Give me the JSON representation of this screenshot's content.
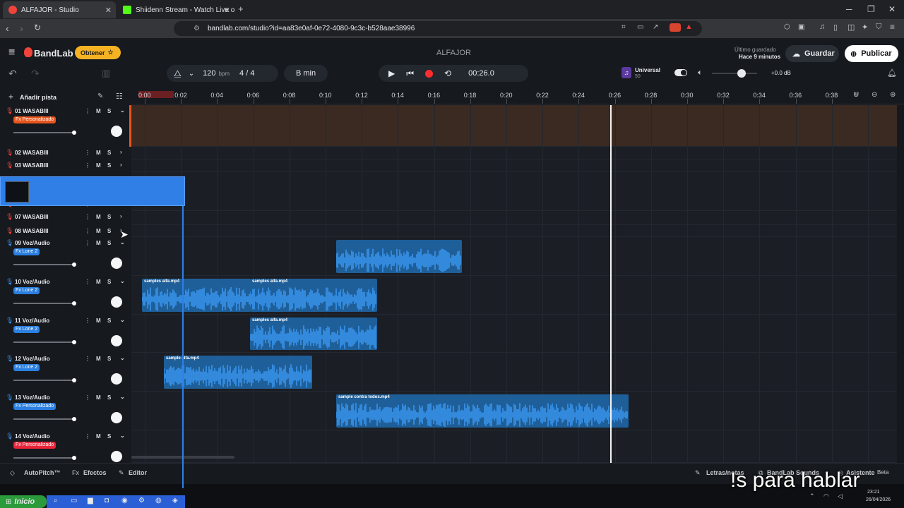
{
  "browser": {
    "tabs": [
      {
        "title": "ALFAJOR - Studio",
        "favicon_color": "#f0443a",
        "close": "✕"
      },
      {
        "title": "Shiidenn Stream - Watch Live on Kick",
        "favicon_color": "#53fc18",
        "close": "✕"
      }
    ],
    "new_tab": "+",
    "url": "bandlab.com/studio?id=aa83e0af-0e72-4080-9c3c-b528aae38996",
    "window_controls": {
      "minimize": "─",
      "maximize": "❐",
      "close": "✕"
    }
  },
  "app": {
    "brand": "BandLab",
    "obtener_label": "Obtener",
    "project_title": "ALFAJOR",
    "last_saved_label": "Último guardado",
    "last_saved_time": "Hace 9 minutos",
    "save_label": "Guardar",
    "publish_label": "Publicar",
    "tempo": "120",
    "tempo_unit": "bpm",
    "time_signature": "4 / 4",
    "key": "B min",
    "time_display": "00:26.0",
    "instrument_name": "Universal",
    "instrument_value": "50",
    "master_volume": "+0.0 dB",
    "master_volume_level": 0.65,
    "add_track_label": "Añadir pista",
    "accent_color": "#f0443a",
    "record_color": "#ff2d2d"
  },
  "ruler": {
    "ticks": [
      "0:00",
      "0:02",
      "0:04",
      "0:06",
      "0:08",
      "0:10",
      "0:12",
      "0:14",
      "0:16",
      "0:18",
      "0:20",
      "0:22",
      "0:24",
      "0:26",
      "0:28",
      "0:30",
      "0:32",
      "0:34",
      "0:36",
      "0:38"
    ]
  },
  "tracks": [
    {
      "name": "01 WASABIII",
      "fx": "Fx Personalizado",
      "fx_color": "#e8551c",
      "icon": "mic-icon",
      "icon_color": "#f0443a",
      "expanded": true,
      "volume": 1.0
    },
    {
      "name": "02 WASABIII",
      "icon": "mic-icon",
      "icon_color": "#f0443a",
      "expanded": false
    },
    {
      "name": "03 WASABIII",
      "icon": "mic-icon",
      "icon_color": "#f0443a",
      "expanded": false
    },
    {
      "name": "06 WASABIII",
      "icon": "mic-icon",
      "icon_color": "#f0443a",
      "expanded": false
    },
    {
      "name": "07 WASABIII",
      "icon": "mic-icon",
      "icon_color": "#f0443a",
      "expanded": false
    },
    {
      "name": "08 WASABIII",
      "icon": "mic-icon",
      "icon_color": "#f0443a",
      "expanded": false
    },
    {
      "name": "09 Voz/Audio",
      "fx": "Fx Lone 2",
      "fx_color": "#2a7fe0",
      "icon": "mic-icon",
      "icon_color": "#3a8fe8",
      "expanded": true,
      "volume": 1.0
    },
    {
      "name": "10 Voz/Audio",
      "fx": "Fx Lone 2",
      "fx_color": "#2a7fe0",
      "icon": "mic-icon",
      "icon_color": "#3a8fe8",
      "expanded": true,
      "volume": 1.0
    },
    {
      "name": "11 Voz/Audio",
      "fx": "Fx Lone 2",
      "fx_color": "#2a7fe0",
      "icon": "mic-icon",
      "icon_color": "#3a8fe8",
      "expanded": true,
      "volume": 1.0
    },
    {
      "name": "12 Voz/Audio",
      "fx": "Fx Lone 2",
      "fx_color": "#2a7fe0",
      "icon": "mic-icon",
      "icon_color": "#3a8fe8",
      "expanded": true,
      "volume": 1.0
    },
    {
      "name": "13 Voz/Audio",
      "fx": "Fx Personalizado",
      "fx_color": "#2a7fe0",
      "icon": "mic-icon",
      "icon_color": "#3a8fe8",
      "expanded": true,
      "volume": 1.0
    },
    {
      "name": "14 Voz/Audio",
      "fx": "Fx Personalizado",
      "fx_color": "#e8253a",
      "icon": "mic-icon",
      "icon_color": "#3a8fe8",
      "expanded": true,
      "volume": 1.0
    }
  ],
  "mute_label": "M",
  "solo_label": "S",
  "clips": [
    {
      "label": "",
      "track": 6
    },
    {
      "label": "samples alfa.mp4",
      "track": 7
    },
    {
      "label": "samples alfa.mp4",
      "track": 7
    },
    {
      "label": "samples alfa.mp4",
      "track": 8
    },
    {
      "label": "sample alfa.mp4",
      "track": 9
    },
    {
      "label": "sample contra todos.mp4",
      "track": 10
    }
  ],
  "playhead_time": "0:26",
  "bottom": {
    "autopitch": "AutoPitch™",
    "effects": "Efectos",
    "editor": "Editor",
    "lyrics": "Letras/notas",
    "sounds": "BandLab Sounds",
    "assistant": "Asistente",
    "assistant_badge": "Beta"
  },
  "taskbar": {
    "start_label": "Inicio",
    "time": "23:21",
    "date": "26/04/2026"
  },
  "overlay_caption": "!s para hablar"
}
